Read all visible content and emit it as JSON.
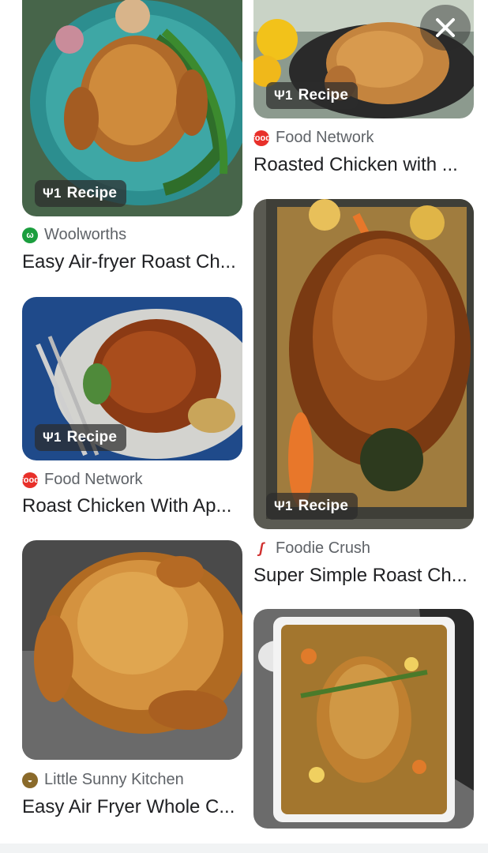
{
  "close_button_glyph": "✕",
  "cards": [
    {
      "source": "Woolworths",
      "title": "Easy Air-fryer Roast Ch...",
      "badge": "Recipe",
      "logo": "woolworths-logo"
    },
    {
      "source": "Food Network",
      "title": "Roasted Chicken with ...",
      "badge": "Recipe",
      "logo": "food-network-logo"
    },
    {
      "source": "Food Network",
      "title": "Roast Chicken With Ap...",
      "badge": "Recipe",
      "logo": "food-network-logo"
    },
    {
      "source": "Foodie Crush",
      "title": "Super Simple Roast Ch...",
      "badge": "Recipe",
      "logo": "foodie-crush-logo"
    },
    {
      "source": "Little Sunny Kitchen",
      "title": "Easy Air Fryer Whole C...",
      "badge": null,
      "logo": "little-sunny-kitchen-logo"
    }
  ],
  "badge_icon": "fork-knife-icon",
  "colors": {
    "text_primary": "#202124",
    "text_secondary": "#5f6368",
    "woolworths_green": "#1b9e3e",
    "food_network_red": "#e8302a",
    "foodie_crush_red": "#d0302f"
  }
}
